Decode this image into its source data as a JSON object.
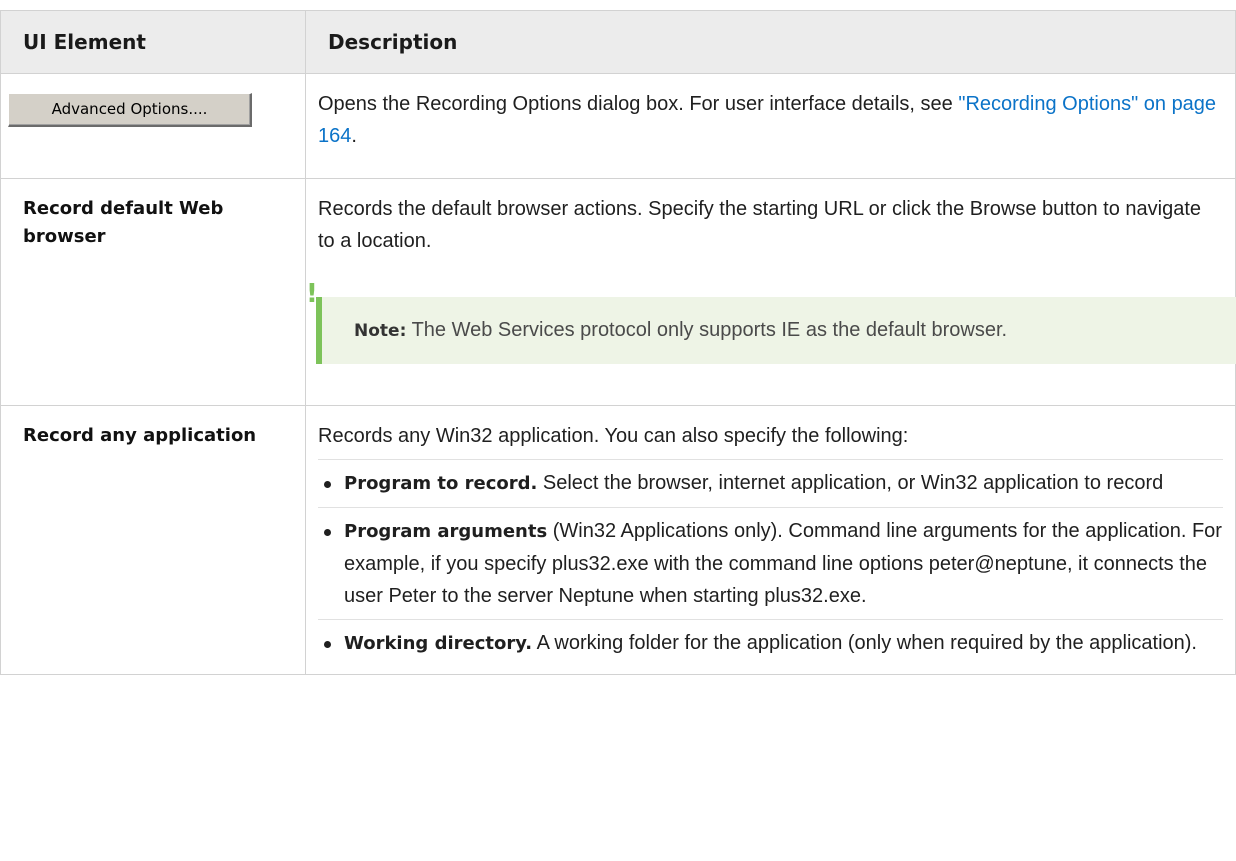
{
  "header": {
    "col1": "UI Element",
    "col2": "Description"
  },
  "rows": {
    "advanced": {
      "button_label": "Advanced Options....",
      "desc": "Opens the Recording Options dialog box. For user interface details, see ",
      "link": "\"Recording Options\" on page 164",
      "desc_end": "."
    },
    "web": {
      "element": "Record default Web browser",
      "desc": "Records the default browser actions. Specify the starting URL or click the Browse button to navigate to a location.",
      "note_label": "Note:",
      "note_text": " The Web Services protocol only supports IE as the default browser."
    },
    "any": {
      "element": "Record any application",
      "desc": "Records any Win32 application. You can also specify the following:",
      "items": [
        {
          "term": "Program to record.",
          "text": " Select the browser, internet application, or Win32 application to record"
        },
        {
          "term": "Program arguments",
          "text": " (Win32 Applications only). Command line arguments for the application. For example, if you specify plus32.exe with the command line options peter@neptune, it connects the user Peter to the server Neptune when starting plus32.exe."
        },
        {
          "term": "Working directory.",
          "text": " A working folder for the application (only when required by the application)."
        }
      ]
    }
  },
  "colors": {
    "link": "#0b73c8",
    "note_accent": "#7dc35a",
    "note_bg": "#eef4e6",
    "header_bg": "#ececec"
  }
}
